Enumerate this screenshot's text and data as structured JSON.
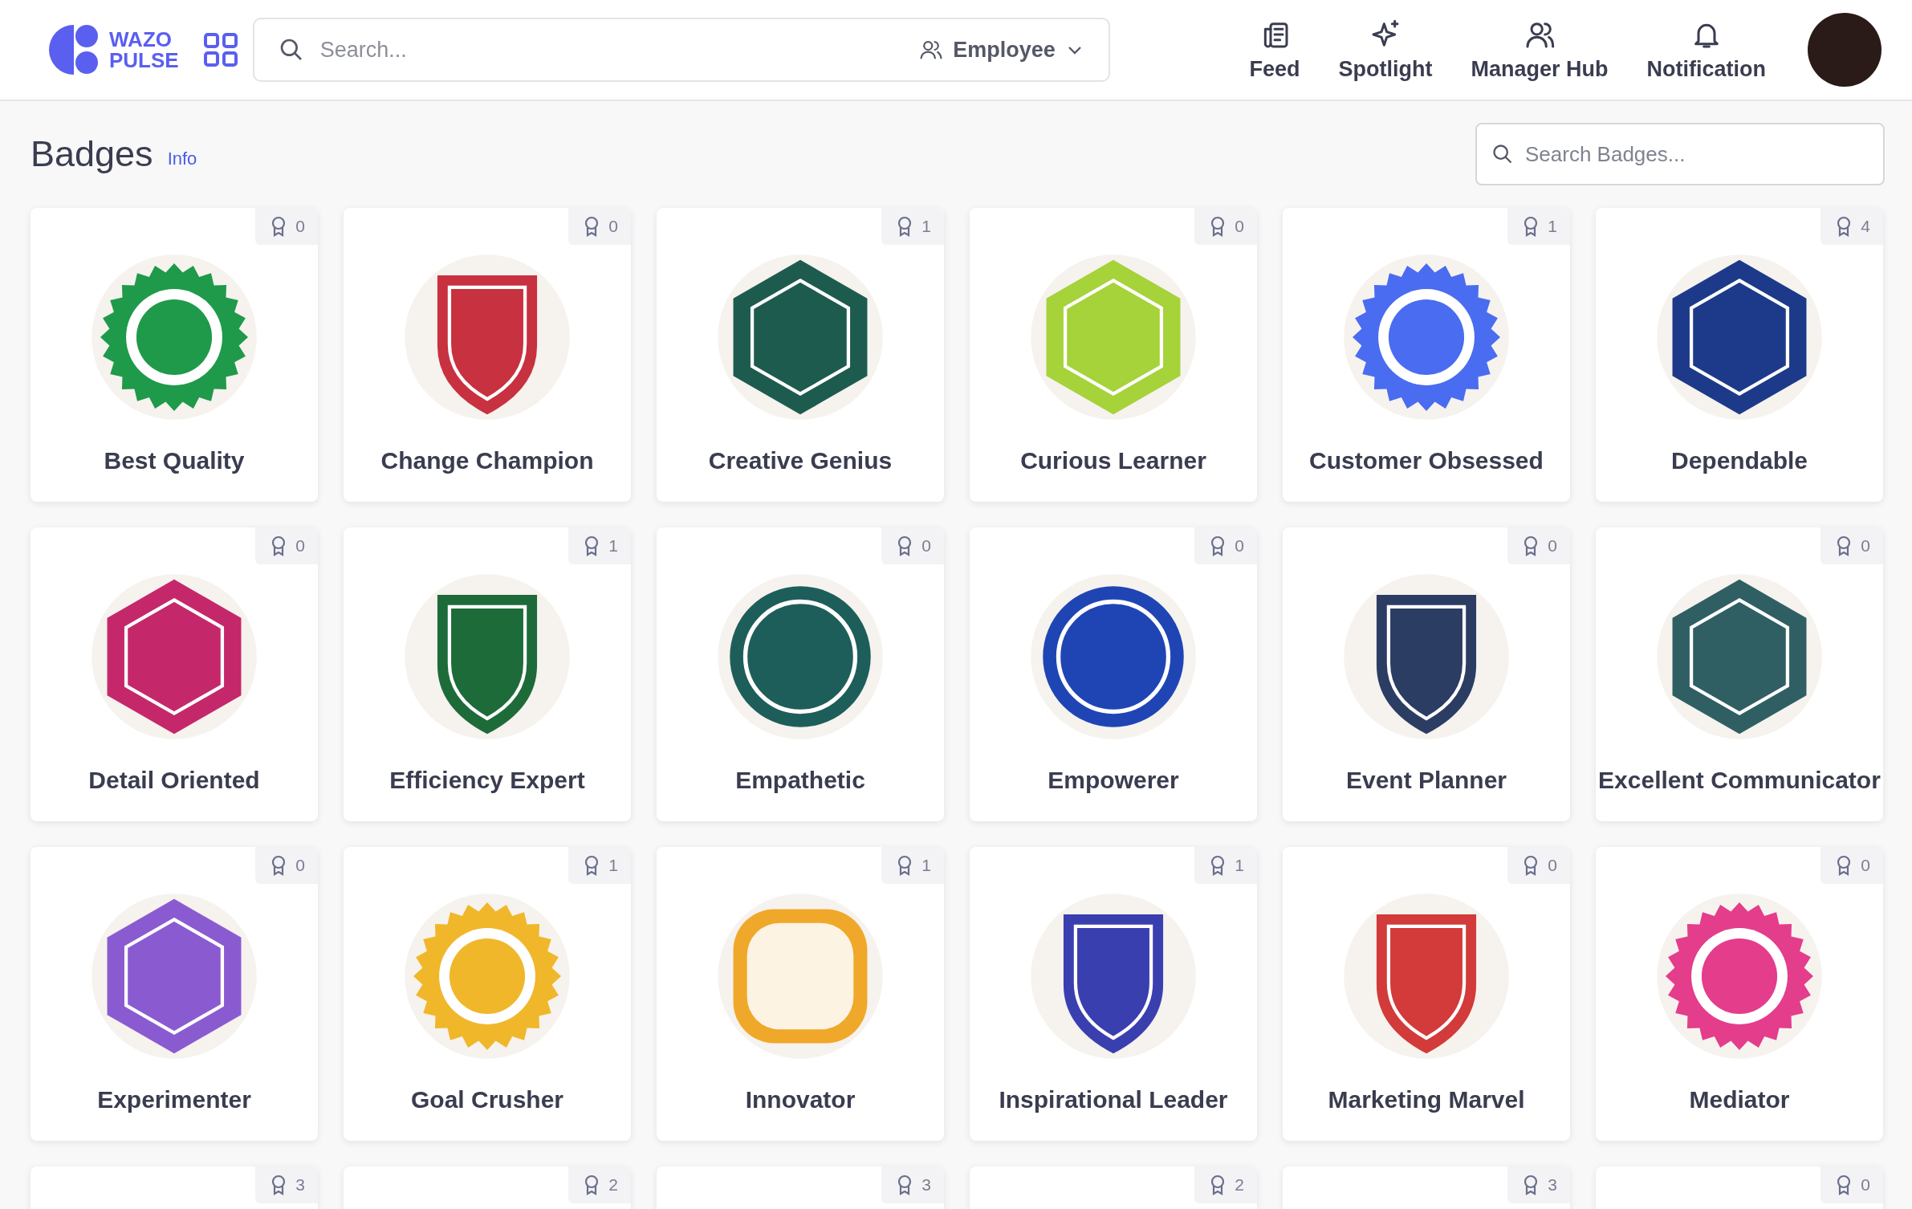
{
  "header": {
    "logo_text": [
      "WAZO",
      "PULSE"
    ],
    "search": {
      "placeholder": "Search..."
    },
    "filter": {
      "label": "Employee"
    },
    "nav": [
      {
        "label": "Feed",
        "kind": "feed"
      },
      {
        "label": "Spotlight",
        "kind": "spotlight"
      },
      {
        "label": "Manager Hub",
        "kind": "hub"
      },
      {
        "label": "Notification",
        "kind": "bell"
      }
    ]
  },
  "page": {
    "title": "Badges",
    "info_link": "Info",
    "search": {
      "placeholder": "Search Badges..."
    }
  },
  "badges": [
    {
      "name": "Best Quality",
      "count": "0",
      "kind": "seal",
      "color": "#1f9a4a"
    },
    {
      "name": "Change Champion",
      "count": "0",
      "kind": "shield",
      "color": "#c8313f"
    },
    {
      "name": "Creative Genius",
      "count": "1",
      "kind": "hexagon",
      "color": "#1e5b4f"
    },
    {
      "name": "Curious Learner",
      "count": "0",
      "kind": "hexagon",
      "color": "#a6d23a"
    },
    {
      "name": "Customer Obsessed",
      "count": "1",
      "kind": "seal",
      "color": "#4a6cf0"
    },
    {
      "name": "Dependable",
      "count": "4",
      "kind": "hexagon",
      "color": "#1d3a8a"
    },
    {
      "name": "Detail Oriented",
      "count": "0",
      "kind": "hexagon",
      "color": "#c4286a"
    },
    {
      "name": "Efficiency Expert",
      "count": "1",
      "kind": "shield",
      "color": "#1e6b3a"
    },
    {
      "name": "Empathetic",
      "count": "0",
      "kind": "circle",
      "color": "#1e5e5a"
    },
    {
      "name": "Empowerer",
      "count": "0",
      "kind": "circle",
      "color": "#1f45b5"
    },
    {
      "name": "Event Planner",
      "count": "0",
      "kind": "shield",
      "color": "#2c3d63"
    },
    {
      "name": "Excellent Communicator",
      "count": "0",
      "kind": "hexagon",
      "color": "#2f5f63"
    },
    {
      "name": "Experimenter",
      "count": "0",
      "kind": "hexagon",
      "color": "#8a5bd0"
    },
    {
      "name": "Goal Crusher",
      "count": "1",
      "kind": "seal",
      "color": "#f0b72a"
    },
    {
      "name": "Innovator",
      "count": "1",
      "kind": "squircle",
      "color": "#f0a82a"
    },
    {
      "name": "Inspirational Leader",
      "count": "1",
      "kind": "shield",
      "color": "#3a3fb0"
    },
    {
      "name": "Marketing Marvel",
      "count": "0",
      "kind": "shield",
      "color": "#d33a3a"
    },
    {
      "name": "Mediator",
      "count": "0",
      "kind": "seal",
      "color": "#e33d8b"
    },
    {
      "count": "3"
    },
    {
      "count": "2"
    },
    {
      "count": "3"
    },
    {
      "count": "2"
    },
    {
      "count": "3"
    },
    {
      "count": "0"
    }
  ]
}
